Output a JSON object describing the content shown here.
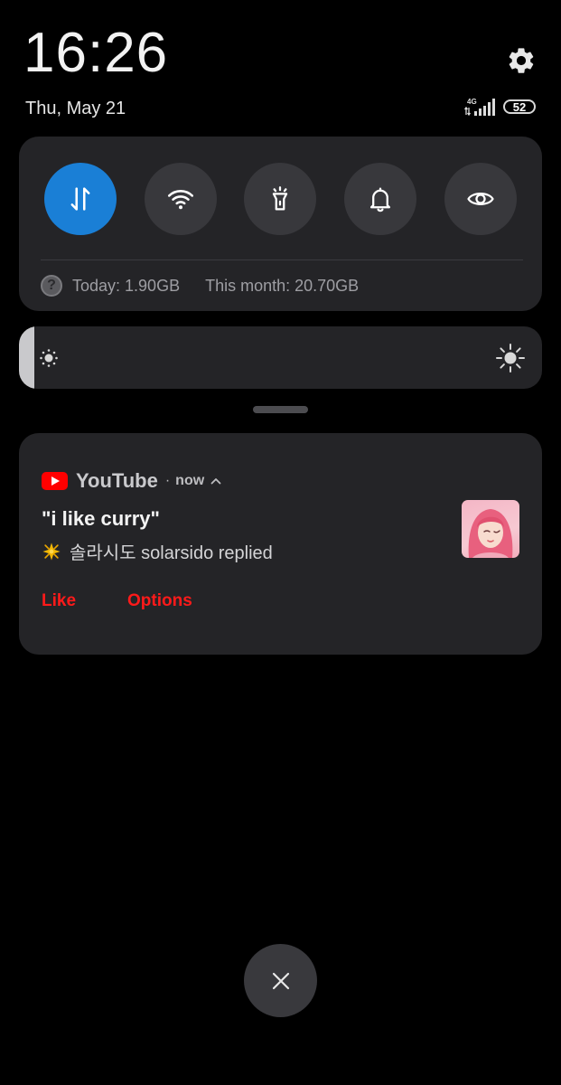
{
  "status_bar": {
    "clock": "16:26",
    "date": "Thu, May 21",
    "network_type": "4G",
    "battery": "52",
    "settings_icon": "gear-icon",
    "signal_icon": "cellular-signal-icon"
  },
  "quick_settings": {
    "toggles": [
      {
        "name": "mobile-data",
        "icon": "data-arrows-icon",
        "active": true
      },
      {
        "name": "wifi",
        "icon": "wifi-icon",
        "active": false
      },
      {
        "name": "flashlight",
        "icon": "flashlight-icon",
        "active": false
      },
      {
        "name": "sound",
        "icon": "bell-icon",
        "active": false
      },
      {
        "name": "reading-mode",
        "icon": "eye-icon",
        "active": false
      }
    ],
    "data_usage": {
      "today": "Today: 1.90GB",
      "month": "This month: 20.70GB",
      "help_glyph": "?"
    }
  },
  "brightness": {
    "level": 0.03,
    "low_icon": "brightness-low-icon",
    "high_icon": "brightness-high-icon"
  },
  "notification": {
    "app": "YouTube",
    "separator": "·",
    "time": "now",
    "title": "\"i like curry\"",
    "body": "솔라시도 solarsido replied",
    "actions": {
      "like": "Like",
      "options": "Options"
    }
  },
  "colors": {
    "accent_blue": "#1a7fd6",
    "youtube_red": "#ff0000",
    "action_red": "#ff1a1a",
    "panel": "#242427"
  },
  "close_icon": "close-icon"
}
